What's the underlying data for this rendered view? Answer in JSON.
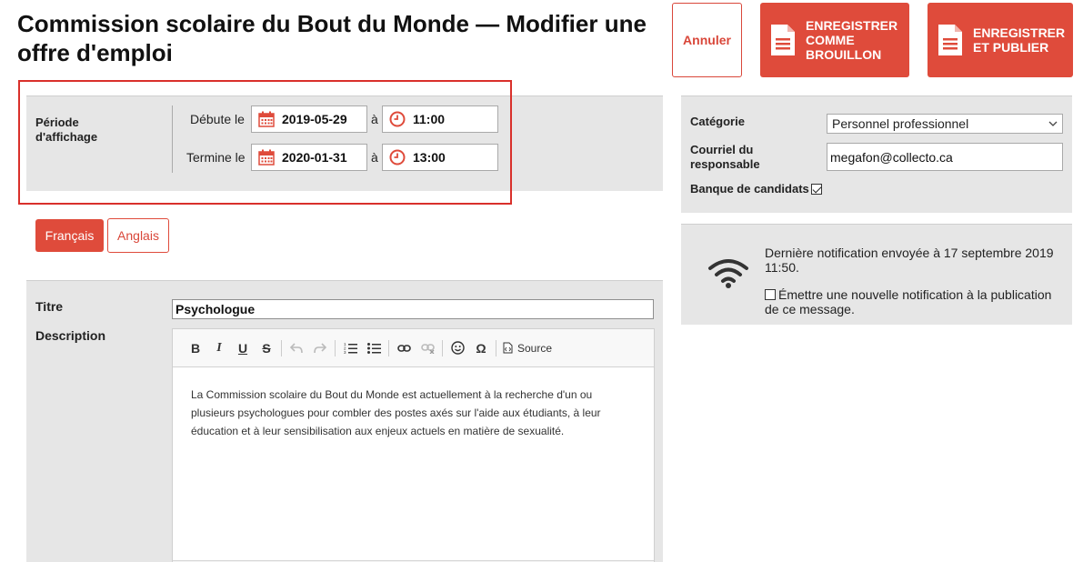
{
  "header": {
    "title": "Commission scolaire du Bout du Monde — Modifier une offre d'emploi"
  },
  "actions": {
    "cancel_label": "Annuler",
    "draft_label_lines": [
      "ENREGISTRER",
      "COMME",
      "BROUILLON"
    ],
    "publish_label_lines": [
      "ENREGISTRER",
      "ET PUBLIER"
    ]
  },
  "period": {
    "label_lines": [
      "Période",
      "d'affichage"
    ],
    "start_label": "Débute le",
    "start_date": "2019-05-29",
    "start_at": "à",
    "start_time": "11:00",
    "end_label": "Termine le",
    "end_date": "2020-01-31",
    "end_at": "à",
    "end_time": "13:00"
  },
  "languages": {
    "fr": "Français",
    "en": "Anglais"
  },
  "form": {
    "title_label": "Titre",
    "title_value": "Psychologue",
    "description_label": "Description",
    "source_label": "Source",
    "description_text": "La Commission scolaire du Bout du Monde est actuellement à la recherche d'un ou plusieurs psychologues pour combler des postes axés sur l'aide aux étudiants, à leur éducation et à leur sensibilisation aux enjeux actuels en matière de sexualité."
  },
  "sidebar": {
    "category_label": "Catégorie",
    "category_value": "Personnel professionnel",
    "email_label_lines": [
      "Courriel du",
      "responsable"
    ],
    "email_value": "megafon@collecto.ca",
    "candidate_bank_label": "Banque de candidats",
    "candidate_bank_checked": true,
    "notification_text": "Dernière notification envoyée à 17 septembre 2019 11:50.",
    "new_notification_label": "Émettre une nouvelle notification à la publication de ce message.",
    "new_notification_checked": false
  },
  "colors": {
    "accent": "#df4b3b",
    "highlight": "#d9302b",
    "panel": "#e6e6e6"
  }
}
